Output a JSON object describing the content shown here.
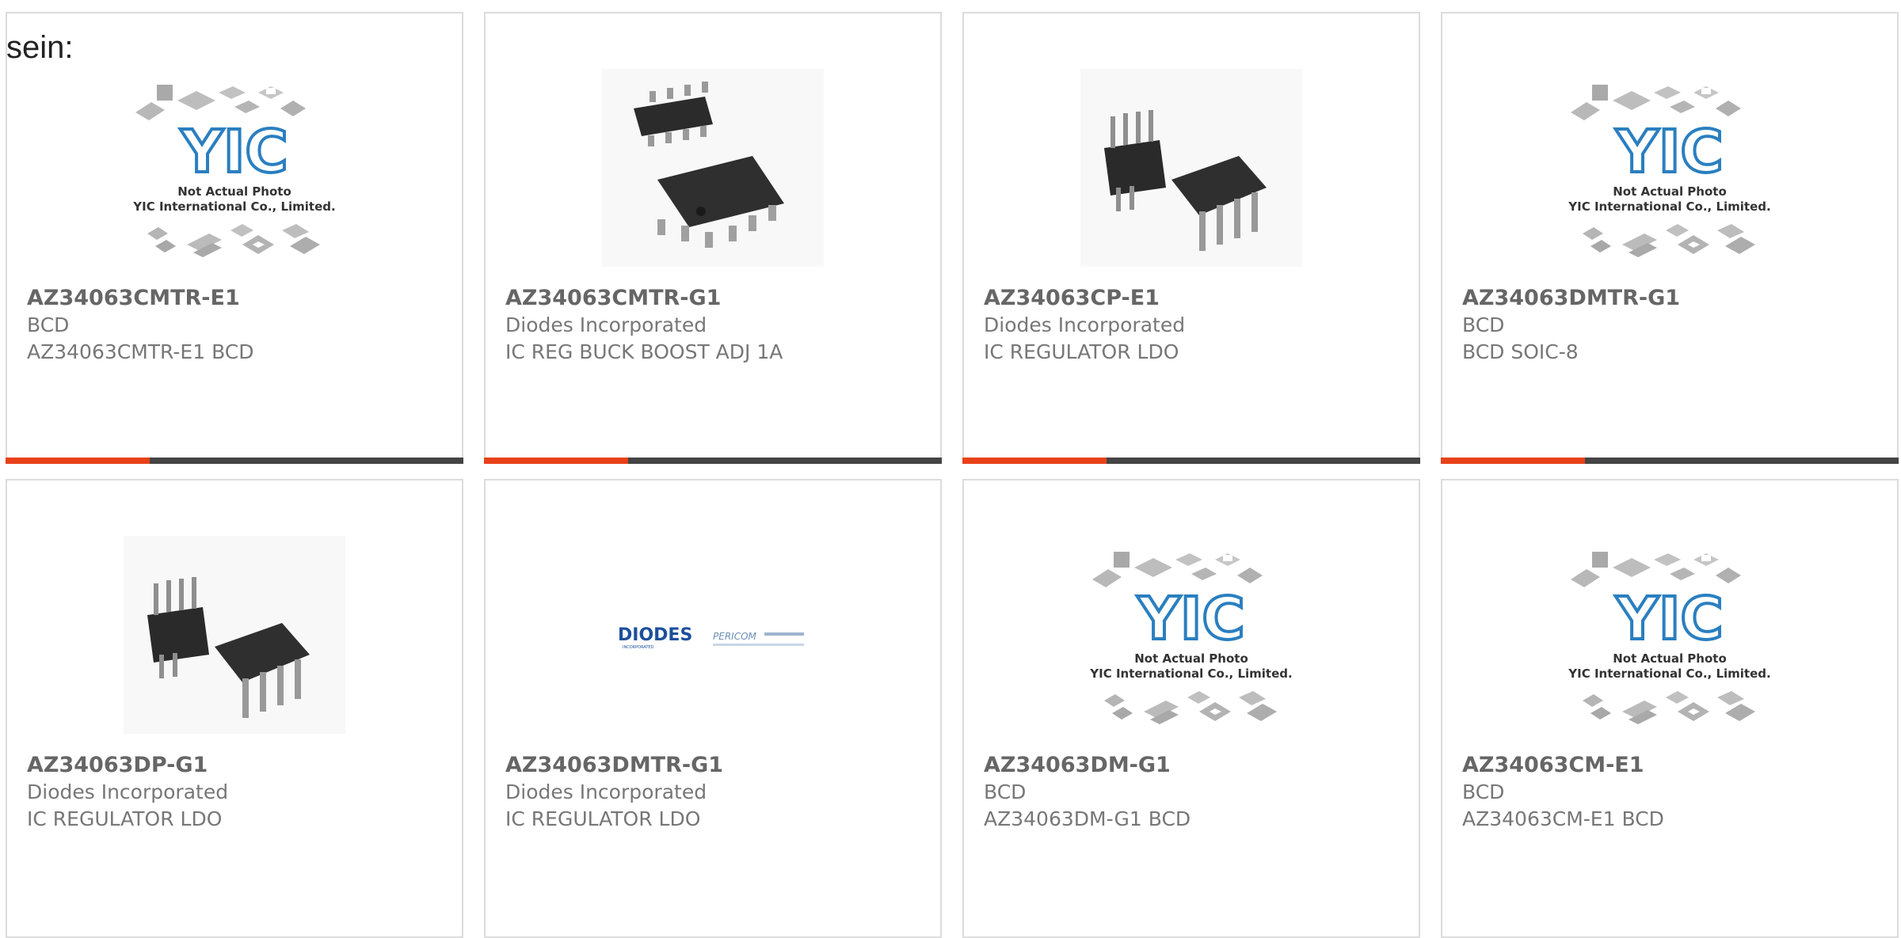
{
  "partial_text": "sein:",
  "colors": {
    "accent": "#e8411a",
    "bar": "#444444",
    "border": "#dcdcdc",
    "yic_blue": "#2a7fc0"
  },
  "placeholder": {
    "line1": "Not Actual Photo",
    "line2": "YIC International Co., Limited.",
    "logo": "YIC"
  },
  "diodes_logo": {
    "brand": "DIODES",
    "sub": "PERICOM"
  },
  "products": [
    {
      "pn": "AZ34063CMTR-E1",
      "mfr": "BCD",
      "desc": "AZ34063CMTR-E1 BCD",
      "image": "yic-placeholder"
    },
    {
      "pn": "AZ34063CMTR-G1",
      "mfr": "Diodes Incorporated",
      "desc": "IC REG BUCK BOOST ADJ 1A",
      "image": "soic-8"
    },
    {
      "pn": "AZ34063CP-E1",
      "mfr": "Diodes Incorporated",
      "desc": "IC REGULATOR LDO",
      "image": "dip-8"
    },
    {
      "pn": "AZ34063DMTR-G1",
      "mfr": "BCD",
      "desc": "BCD SOIC-8",
      "image": "yic-placeholder"
    },
    {
      "pn": "AZ34063DP-G1",
      "mfr": "Diodes Incorporated",
      "desc": "IC REGULATOR LDO",
      "image": "dip-8"
    },
    {
      "pn": "AZ34063DMTR-G1",
      "mfr": "Diodes Incorporated",
      "desc": "IC REGULATOR LDO",
      "image": "diodes-logo"
    },
    {
      "pn": "AZ34063DM-G1",
      "mfr": "BCD",
      "desc": "AZ34063DM-G1 BCD",
      "image": "yic-placeholder"
    },
    {
      "pn": "AZ34063CM-E1",
      "mfr": "BCD",
      "desc": "AZ34063CM-E1 BCD",
      "image": "yic-placeholder"
    }
  ]
}
